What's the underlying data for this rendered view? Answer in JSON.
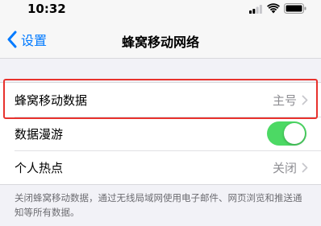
{
  "status_bar": {
    "time": "10:32"
  },
  "nav": {
    "back_label": "设置",
    "title": "蜂窝移动网络"
  },
  "rows": [
    {
      "label": "蜂窝移动数据",
      "value": "主号"
    },
    {
      "label": "数据漫游",
      "toggle_on": true
    },
    {
      "label": "个人热点",
      "value": "关闭"
    }
  ],
  "footer": {
    "note": "关闭蜂窝移动数据，通过无线局域网使用电子邮件、网页浏览和推送通知等所有数据。"
  },
  "colors": {
    "accent": "#007aff",
    "toggle_on": "#4cd964",
    "highlight": "#e8322d"
  },
  "icons": [
    "signal-icon",
    "wifi-icon",
    "battery-icon",
    "chevron-left-icon",
    "chevron-right-icon"
  ]
}
